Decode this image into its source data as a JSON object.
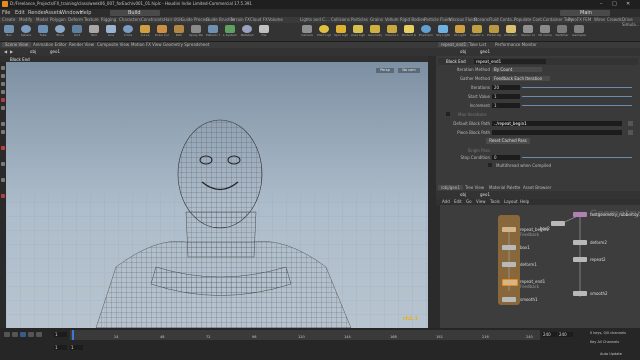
{
  "colors": {
    "accent_orange": "#e68a1f",
    "node_orange": "#c86a10",
    "build_btn": "#4a4a4a",
    "loop_block": "#d2b58a"
  },
  "window": {
    "title": "D:/Freelance_Projects/FX_training/class/week06_007_forEach/v001_01.hiplc - Houdini Indie Limited-Commercial 17.5.391",
    "build_label": "Build",
    "main_label": "Main"
  },
  "menu": [
    "File",
    "Edit",
    "Render",
    "Assets",
    "Windows",
    "Help"
  ],
  "shelf_tabs_left": [
    "Create",
    "Modify",
    "Model",
    "Polygon",
    "Deform",
    "Texture",
    "Rigging",
    "Characters",
    "Constraints",
    "Hair Utils",
    "Guide Process",
    "Guide Brushes",
    "Terrain FX",
    "Cloud FX",
    "Volume"
  ],
  "shelf_tabs_right": [
    "Lights and C...",
    "Collisions",
    "Particles",
    "Grains",
    "Vellum",
    "Rigid Bodies",
    "Particle Fluids",
    "Viscous Fluids",
    "Oceans",
    "Fluid Conta...",
    "Populate Cont...",
    "Container Tools",
    "PyroFX",
    "FEM",
    "Wires",
    "Crowds",
    "Drive Simula..."
  ],
  "tools_left": [
    "Box",
    "Sphere",
    "Tube",
    "Torus",
    "Grid",
    "Null",
    "Line",
    "Circle",
    "Curve",
    "Draw Curve",
    "Path",
    "Spray Paint",
    "Platonic Solids",
    "L-System",
    "Metaball",
    "File"
  ],
  "tools_right": [
    "Camera",
    "Point Light",
    "Spot Light",
    "Area Light",
    "Geometry Light",
    "Volume Light",
    "Distant Light",
    "Environment Light",
    "Sky Light",
    "GI Light",
    "Caustic Light",
    "Portal Light",
    "Ambient Light",
    "Stereo Camera",
    "VR Camera",
    "Switcher",
    "Gamepad Camera"
  ],
  "left_pane_tabs": [
    "Scene View",
    "Animation Editor",
    "Render View",
    "Composite View",
    "Motion FX View",
    "Geometry Spreadsheet"
  ],
  "viewport": {
    "path_obj": "obj",
    "path_node": "geo1",
    "label": "Block End",
    "persp": "Persp",
    "nocam": "No cam"
  },
  "right_top_tabs": [
    "repeat_end1",
    "Take List",
    "Performance Monitor"
  ],
  "right_path": {
    "obj": "obj",
    "node": "geo1"
  },
  "params": {
    "node_type": "Block End",
    "node_name": "repeat_end1",
    "rows": [
      {
        "label": "Iteration Method",
        "value": "By Count"
      },
      {
        "label": "Gather Method",
        "value": "Feedback Each Iteration"
      },
      {
        "label": "Iterations",
        "value": "20"
      },
      {
        "label": "Start Value",
        "value": "1"
      },
      {
        "label": "Increment",
        "value": "1"
      },
      {
        "label": "Stop Condition",
        "value": "0"
      }
    ],
    "use_max": "Max Iterations",
    "block_path_label": "Default Block Path",
    "block_path": "../repeat_begin1",
    "piece_block_label": "Piece Block Path",
    "reset_button": "Reset Cached Pass",
    "single_pass": "Single Pass",
    "multithread": "Multithread when Compiled"
  },
  "bottom_tabs": [
    "/obj/geo1",
    "Tree View",
    "Material Palette",
    "Asset Browser"
  ],
  "net_menu": [
    "Add",
    "Edit",
    "Go",
    "View",
    "Tools",
    "Layout",
    "Help"
  ],
  "net_watermark": "Geometry",
  "nodes": [
    "repeat_begin1",
    "box1",
    "deform1",
    "repeat_end1",
    "smooth1",
    "testgeometry_rubbertoy1",
    "box2",
    "deform2",
    "repeat2",
    "smooth2"
  ],
  "node_sub": [
    "Feedback",
    "Feedback"
  ],
  "timeline": {
    "frame": "1",
    "start": "1",
    "start2": "1",
    "end": "240",
    "end2": "240",
    "keys": "0 keys, 0/0 channels",
    "key_all": "Key All Channels",
    "auto_update": "Auto Update"
  },
  "ticks": [
    "24",
    "48",
    "72",
    "96",
    "120",
    "144",
    "168",
    "192",
    "216",
    "240"
  ],
  "watermark": "ch2.1"
}
